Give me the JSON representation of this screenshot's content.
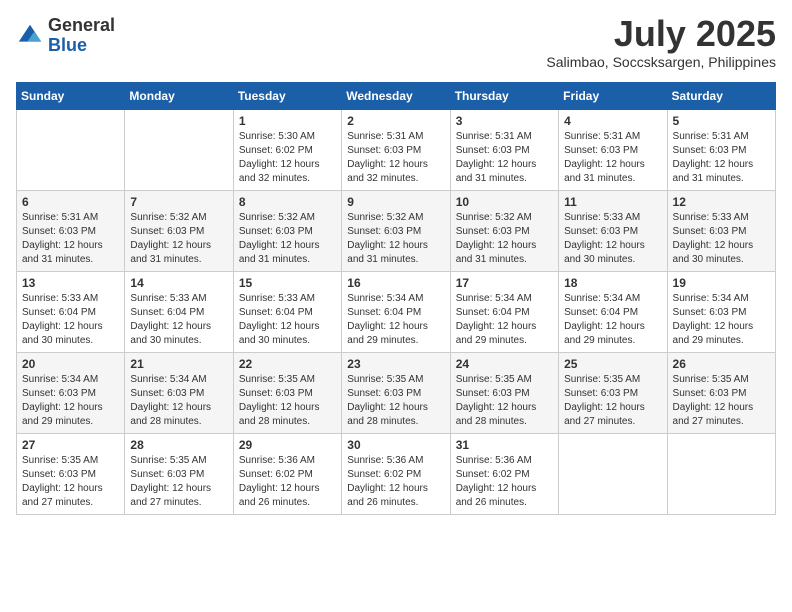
{
  "header": {
    "logo_general": "General",
    "logo_blue": "Blue",
    "month_year": "July 2025",
    "location": "Salimbao, Soccsksargen, Philippines"
  },
  "days_of_week": [
    "Sunday",
    "Monday",
    "Tuesday",
    "Wednesday",
    "Thursday",
    "Friday",
    "Saturday"
  ],
  "weeks": [
    [
      {
        "day": "",
        "info": ""
      },
      {
        "day": "",
        "info": ""
      },
      {
        "day": "1",
        "info": "Sunrise: 5:30 AM\nSunset: 6:02 PM\nDaylight: 12 hours\nand 32 minutes."
      },
      {
        "day": "2",
        "info": "Sunrise: 5:31 AM\nSunset: 6:03 PM\nDaylight: 12 hours\nand 32 minutes."
      },
      {
        "day": "3",
        "info": "Sunrise: 5:31 AM\nSunset: 6:03 PM\nDaylight: 12 hours\nand 31 minutes."
      },
      {
        "day": "4",
        "info": "Sunrise: 5:31 AM\nSunset: 6:03 PM\nDaylight: 12 hours\nand 31 minutes."
      },
      {
        "day": "5",
        "info": "Sunrise: 5:31 AM\nSunset: 6:03 PM\nDaylight: 12 hours\nand 31 minutes."
      }
    ],
    [
      {
        "day": "6",
        "info": "Sunrise: 5:31 AM\nSunset: 6:03 PM\nDaylight: 12 hours\nand 31 minutes."
      },
      {
        "day": "7",
        "info": "Sunrise: 5:32 AM\nSunset: 6:03 PM\nDaylight: 12 hours\nand 31 minutes."
      },
      {
        "day": "8",
        "info": "Sunrise: 5:32 AM\nSunset: 6:03 PM\nDaylight: 12 hours\nand 31 minutes."
      },
      {
        "day": "9",
        "info": "Sunrise: 5:32 AM\nSunset: 6:03 PM\nDaylight: 12 hours\nand 31 minutes."
      },
      {
        "day": "10",
        "info": "Sunrise: 5:32 AM\nSunset: 6:03 PM\nDaylight: 12 hours\nand 31 minutes."
      },
      {
        "day": "11",
        "info": "Sunrise: 5:33 AM\nSunset: 6:03 PM\nDaylight: 12 hours\nand 30 minutes."
      },
      {
        "day": "12",
        "info": "Sunrise: 5:33 AM\nSunset: 6:03 PM\nDaylight: 12 hours\nand 30 minutes."
      }
    ],
    [
      {
        "day": "13",
        "info": "Sunrise: 5:33 AM\nSunset: 6:04 PM\nDaylight: 12 hours\nand 30 minutes."
      },
      {
        "day": "14",
        "info": "Sunrise: 5:33 AM\nSunset: 6:04 PM\nDaylight: 12 hours\nand 30 minutes."
      },
      {
        "day": "15",
        "info": "Sunrise: 5:33 AM\nSunset: 6:04 PM\nDaylight: 12 hours\nand 30 minutes."
      },
      {
        "day": "16",
        "info": "Sunrise: 5:34 AM\nSunset: 6:04 PM\nDaylight: 12 hours\nand 29 minutes."
      },
      {
        "day": "17",
        "info": "Sunrise: 5:34 AM\nSunset: 6:04 PM\nDaylight: 12 hours\nand 29 minutes."
      },
      {
        "day": "18",
        "info": "Sunrise: 5:34 AM\nSunset: 6:04 PM\nDaylight: 12 hours\nand 29 minutes."
      },
      {
        "day": "19",
        "info": "Sunrise: 5:34 AM\nSunset: 6:03 PM\nDaylight: 12 hours\nand 29 minutes."
      }
    ],
    [
      {
        "day": "20",
        "info": "Sunrise: 5:34 AM\nSunset: 6:03 PM\nDaylight: 12 hours\nand 29 minutes."
      },
      {
        "day": "21",
        "info": "Sunrise: 5:34 AM\nSunset: 6:03 PM\nDaylight: 12 hours\nand 28 minutes."
      },
      {
        "day": "22",
        "info": "Sunrise: 5:35 AM\nSunset: 6:03 PM\nDaylight: 12 hours\nand 28 minutes."
      },
      {
        "day": "23",
        "info": "Sunrise: 5:35 AM\nSunset: 6:03 PM\nDaylight: 12 hours\nand 28 minutes."
      },
      {
        "day": "24",
        "info": "Sunrise: 5:35 AM\nSunset: 6:03 PM\nDaylight: 12 hours\nand 28 minutes."
      },
      {
        "day": "25",
        "info": "Sunrise: 5:35 AM\nSunset: 6:03 PM\nDaylight: 12 hours\nand 27 minutes."
      },
      {
        "day": "26",
        "info": "Sunrise: 5:35 AM\nSunset: 6:03 PM\nDaylight: 12 hours\nand 27 minutes."
      }
    ],
    [
      {
        "day": "27",
        "info": "Sunrise: 5:35 AM\nSunset: 6:03 PM\nDaylight: 12 hours\nand 27 minutes."
      },
      {
        "day": "28",
        "info": "Sunrise: 5:35 AM\nSunset: 6:03 PM\nDaylight: 12 hours\nand 27 minutes."
      },
      {
        "day": "29",
        "info": "Sunrise: 5:36 AM\nSunset: 6:02 PM\nDaylight: 12 hours\nand 26 minutes."
      },
      {
        "day": "30",
        "info": "Sunrise: 5:36 AM\nSunset: 6:02 PM\nDaylight: 12 hours\nand 26 minutes."
      },
      {
        "day": "31",
        "info": "Sunrise: 5:36 AM\nSunset: 6:02 PM\nDaylight: 12 hours\nand 26 minutes."
      },
      {
        "day": "",
        "info": ""
      },
      {
        "day": "",
        "info": ""
      }
    ]
  ]
}
